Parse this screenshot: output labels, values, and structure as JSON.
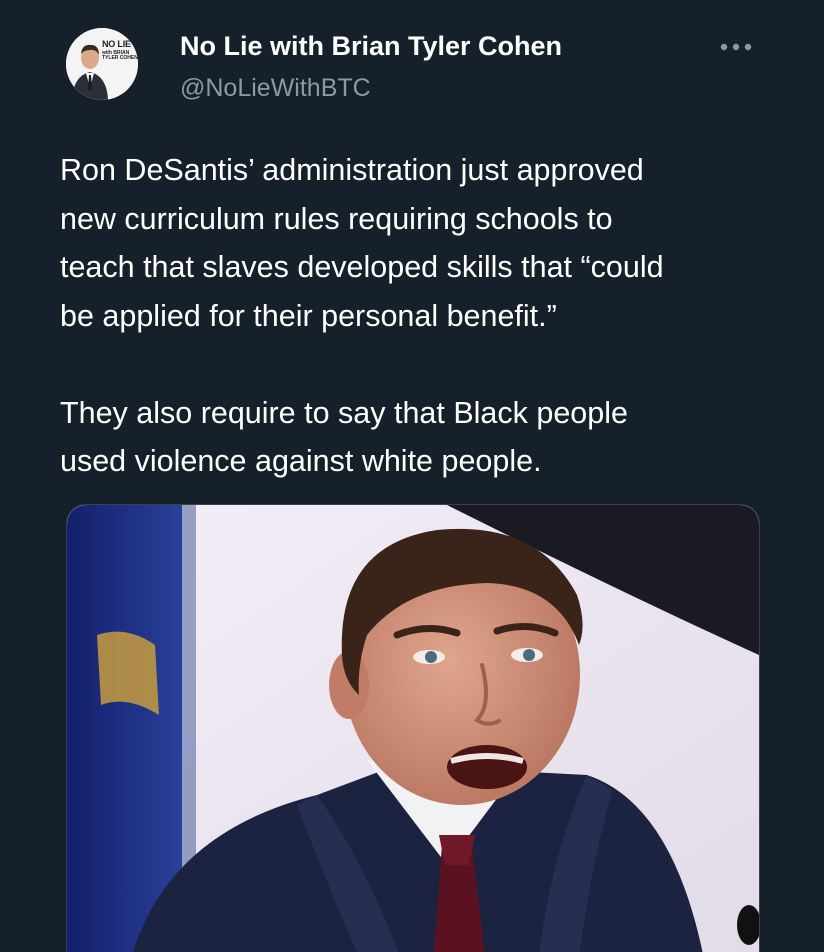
{
  "author": {
    "name": "No Lie with Brian Tyler Cohen",
    "handle": "@NoLieWithBTC",
    "avatar_logo_line1": "NO LIE",
    "avatar_logo_line2": "with BRIAN TYLER COHEN"
  },
  "tweet": {
    "paragraphs": [
      [
        "Ron DeSantis’ administration just approved",
        "new curriculum rules requiring schools to",
        "teach that slaves developed skills that “could",
        "be applied for their personal benefit.”"
      ],
      [
        "They also require to say that Black people",
        "used violence against white people."
      ]
    ]
  },
  "icons": {
    "more": "more-horizontal-icon"
  },
  "colors": {
    "background": "#15202b",
    "text_primary": "#ffffff",
    "text_secondary": "#8b98a5",
    "border": "#38444d"
  }
}
